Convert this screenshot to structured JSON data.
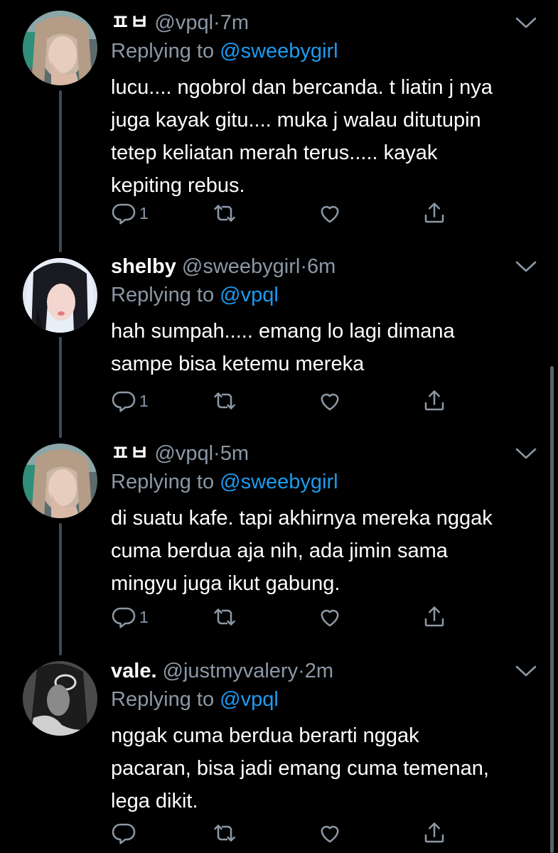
{
  "tweets": [
    {
      "name": "ㅍㅂ",
      "handle": "@vpql",
      "dot": "·",
      "time": "7m",
      "replying_prefix": "Replying to",
      "replying_to": "@sweebygirl",
      "lines": [
        "lucu.... ngobrol dan bercanda. t liatin j nya",
        "juga kayak gitu.... muka j walau ditutupin",
        "tetep keliatan merah terus..... kayak",
        "kepiting rebus."
      ],
      "reply_count": "1",
      "retweet_count": "",
      "like_count": ""
    },
    {
      "name": "shelby",
      "handle": "@sweebygirl",
      "dot": "·",
      "time": "6m",
      "replying_prefix": "Replying to",
      "replying_to": "@vpql",
      "lines": [
        "hah sumpah..... emang lo lagi dimana",
        "sampe bisa ketemu mereka"
      ],
      "reply_count": "1",
      "retweet_count": "",
      "like_count": ""
    },
    {
      "name": "ㅍㅂ",
      "handle": "@vpql",
      "dot": "·",
      "time": "5m",
      "replying_prefix": "Replying to",
      "replying_to": "@sweebygirl",
      "lines": [
        "di suatu kafe. tapi akhirnya mereka nggak",
        "cuma berdua aja nih, ada jimin sama",
        "mingyu juga ikut gabung."
      ],
      "reply_count": "1",
      "retweet_count": "",
      "like_count": ""
    },
    {
      "name": "vale.",
      "handle": "@justmyvalery",
      "dot": "·",
      "time": "2m",
      "replying_prefix": "Replying to",
      "replying_to": "@vpql",
      "lines": [
        "nggak cuma berdua berarti nggak",
        "pacaran, bisa jadi emang cuma temenan,",
        "lega dikit."
      ],
      "reply_count": "",
      "retweet_count": "",
      "like_count": ""
    }
  ],
  "icons": {
    "reply": "reply-icon",
    "retweet": "retweet-icon",
    "like": "heart-icon",
    "share": "share-icon",
    "more": "chevron-down-icon"
  },
  "colors": {
    "background": "#000000",
    "text": "#ffffff",
    "secondary": "#8b98a5",
    "link": "#1d9bf0",
    "thread_line": "#3d4a57"
  }
}
